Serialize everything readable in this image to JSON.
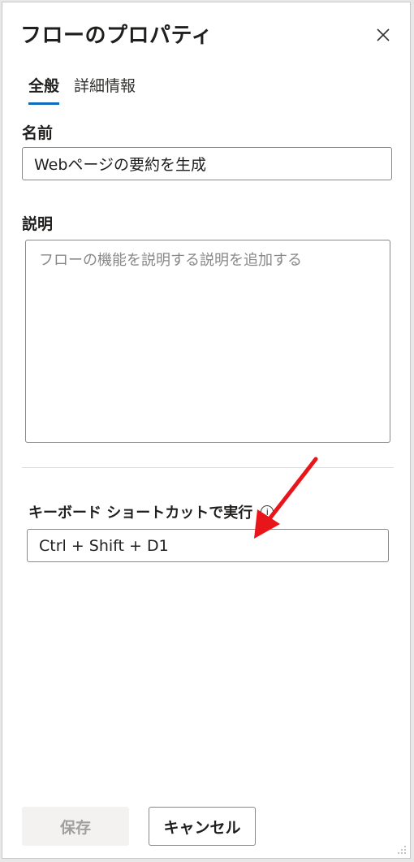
{
  "dialog": {
    "title": "フローのプロパティ",
    "close_icon": "close-icon"
  },
  "tabs": [
    {
      "label": "全般",
      "active": true
    },
    {
      "label": "詳細情報",
      "active": false
    }
  ],
  "name_field": {
    "label": "名前",
    "value": "Webページの要約を生成"
  },
  "description_field": {
    "label": "説明",
    "placeholder": "フローの機能を説明する説明を追加する",
    "value": ""
  },
  "shortcut_field": {
    "label": "キーボード ショートカットで実行",
    "info_icon": "ⓘ",
    "value": "Ctrl + Shift + D1"
  },
  "buttons": {
    "save_label": "保存",
    "cancel_label": "キャンセル"
  },
  "colors": {
    "accent": "#0f6cbd",
    "annotation_arrow": "#e8161b"
  }
}
